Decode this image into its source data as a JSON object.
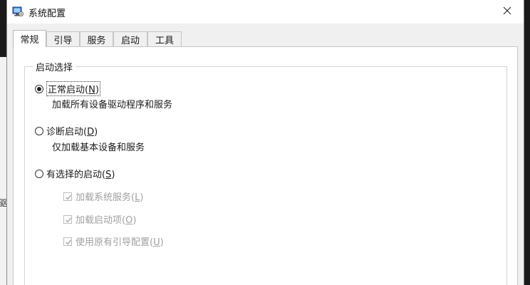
{
  "window": {
    "title": "系统配置",
    "close_glyph": "✕"
  },
  "tabs": [
    {
      "label": "常规",
      "active": true
    },
    {
      "label": "引导",
      "active": false
    },
    {
      "label": "服务",
      "active": false
    },
    {
      "label": "启动",
      "active": false
    },
    {
      "label": "工具",
      "active": false
    }
  ],
  "startup_selection": {
    "legend": "启动选择",
    "options": [
      {
        "text": "正常启动(",
        "key": "N",
        "suffix": ")",
        "selected": true,
        "description": "加载所有设备驱动程序和服务"
      },
      {
        "text": "诊断启动(",
        "key": "D",
        "suffix": ")",
        "selected": false,
        "description": "仅加载基本设备和服务"
      },
      {
        "text": "有选择的启动(",
        "key": "S",
        "suffix": ")",
        "selected": false,
        "description": ""
      }
    ],
    "selective_items": [
      {
        "text": "加载系统服务(",
        "key": "L",
        "suffix": ")",
        "checked": true,
        "enabled": false
      },
      {
        "text": "加载启动项(",
        "key": "O",
        "suffix": ")",
        "checked": true,
        "enabled": false
      },
      {
        "text": "使用原有引导配置(",
        "key": "U",
        "suffix": ")",
        "checked": true,
        "enabled": false
      }
    ]
  },
  "background": {
    "left_edge_glyph": "驱"
  },
  "icons": {
    "app": "msconfig-icon",
    "close": "close-icon",
    "check": "checkmark-icon"
  },
  "colors": {
    "titlebar": "#ffffff",
    "window_bg": "#f0f0f0",
    "panel_bg": "#ffffff",
    "disabled_text": "#a0a0a0"
  }
}
